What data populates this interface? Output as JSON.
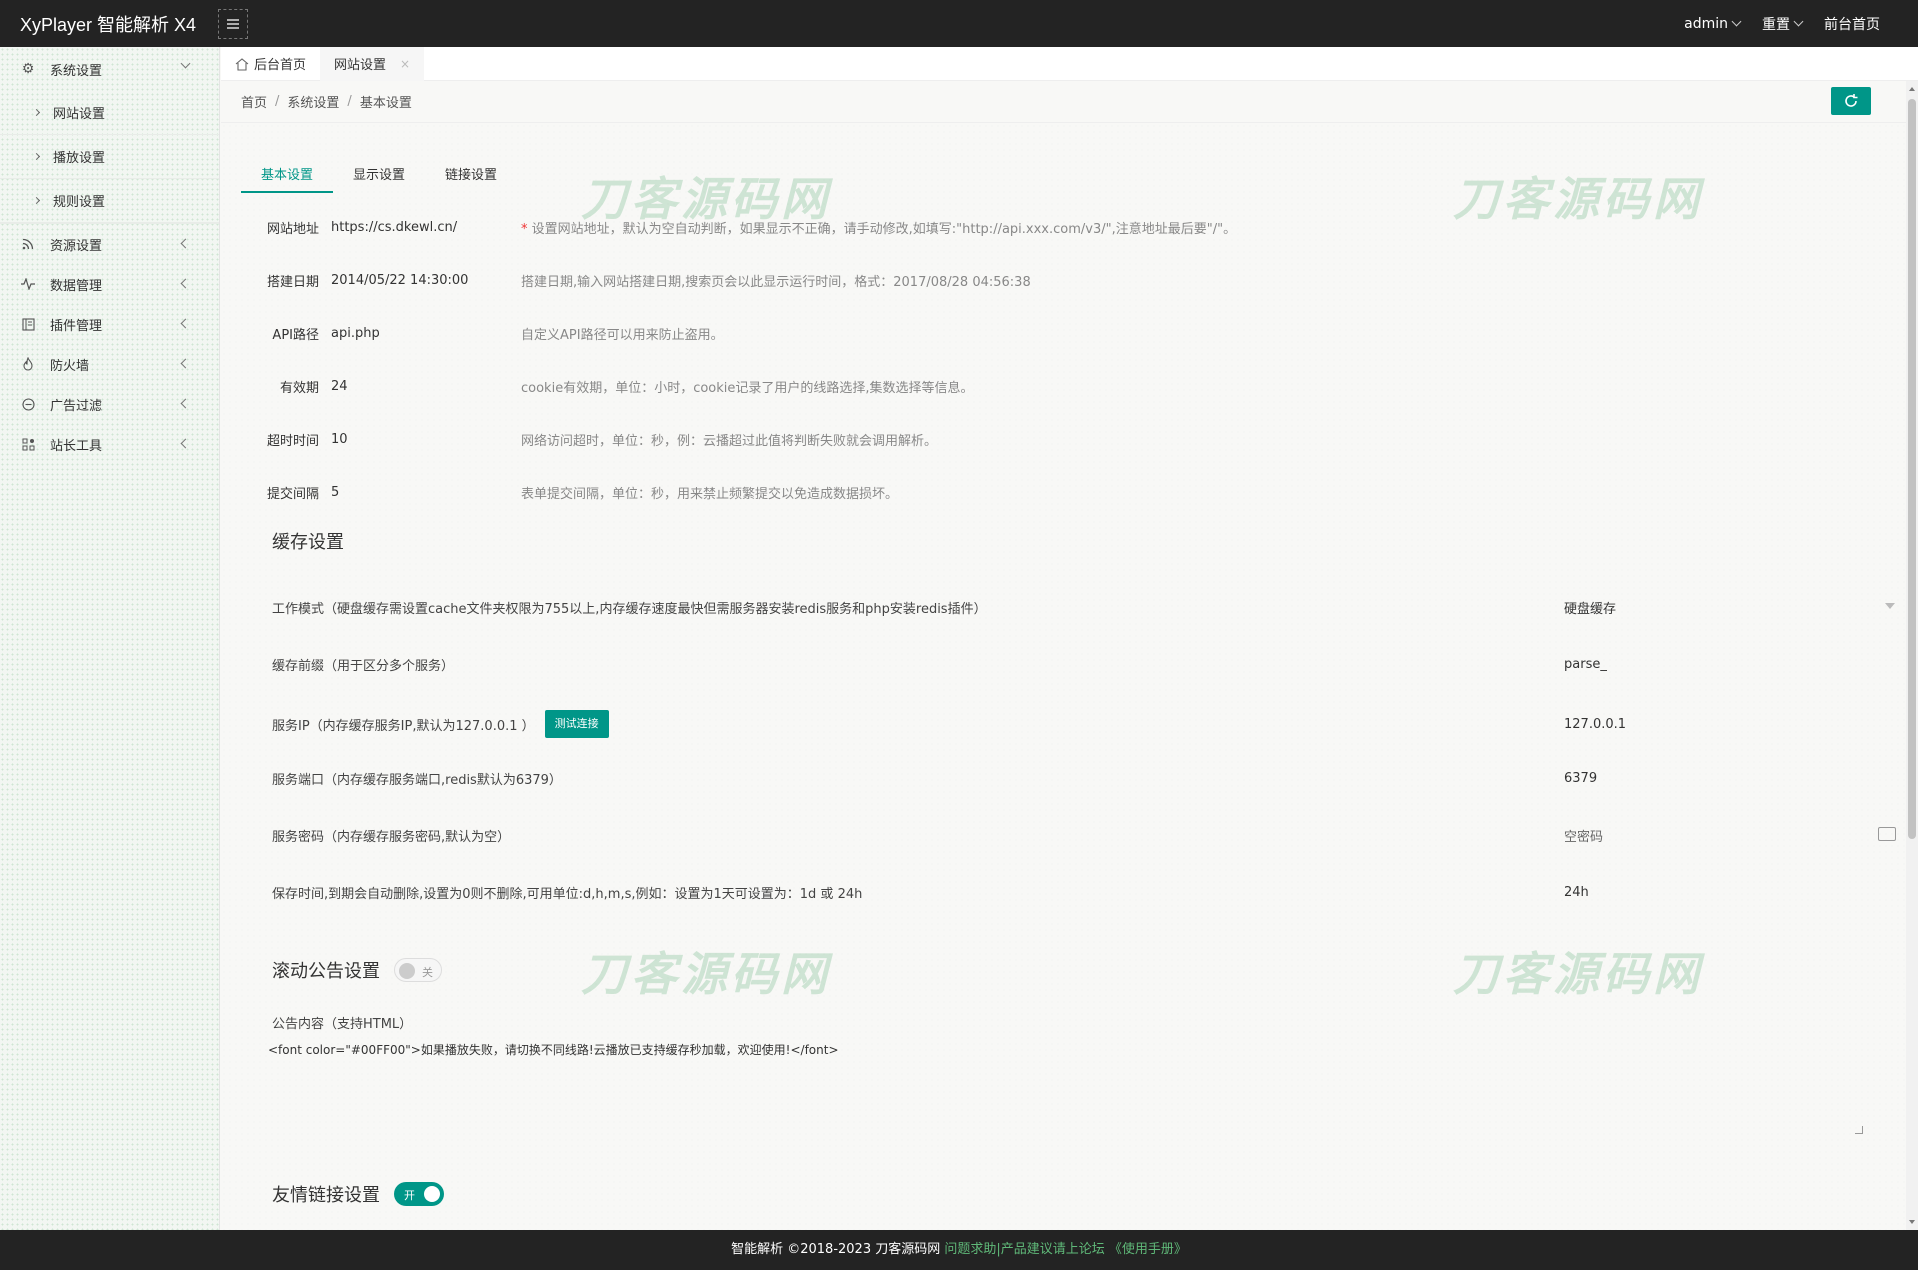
{
  "app": {
    "title": "XyPlayer 智能解析 X4"
  },
  "header": {
    "user": "admin",
    "reset": "重置",
    "front": "前台首页"
  },
  "sidebar": {
    "items": [
      {
        "label": "系统设置",
        "icon": "gear-icon",
        "expanded": true,
        "children": [
          "网站设置",
          "播放设置",
          "规则设置"
        ]
      },
      {
        "label": "资源设置",
        "icon": "rss-icon"
      },
      {
        "label": "数据管理",
        "icon": "pulse-icon"
      },
      {
        "label": "插件管理",
        "icon": "plugin-icon"
      },
      {
        "label": "防火墙",
        "icon": "fire-icon"
      },
      {
        "label": "广告过滤",
        "icon": "minus-circle-icon"
      },
      {
        "label": "站长工具",
        "icon": "apps-icon"
      }
    ]
  },
  "tabs": {
    "home": "后台首页",
    "current": "网站设置",
    "close": "×"
  },
  "breadcrumb": {
    "home": "首页",
    "sep": "/",
    "level2": "系统设置",
    "level3": "基本设置"
  },
  "subtabs": [
    "基本设置",
    "显示设置",
    "链接设置"
  ],
  "basic_fields": [
    {
      "label": "网站地址",
      "value": "https://cs.dkewl.cn/",
      "star": "*",
      "tip": " 设置网站地址，默认为空自动判断，如果显示不正确，请手动修改,如填写:\"http://api.xxx.com/v3/\",注意地址最后要\"/\"。"
    },
    {
      "label": "搭建日期",
      "value": "2014/05/22 14:30:00",
      "star": "",
      "tip": "搭建日期,输入网站搭建日期,搜索页会以此显示运行时间，格式：2017/08/28 04:56:38"
    },
    {
      "label": "API路径",
      "value": "api.php",
      "star": "",
      "tip": "自定义API路径可以用来防止盗用。"
    },
    {
      "label": "有效期",
      "value": "24",
      "star": "",
      "tip": "cookie有效期，单位：小时，cookie记录了用户的线路选择,集数选择等信息。"
    },
    {
      "label": "超时时间",
      "value": "10",
      "star": "",
      "tip": "网络访问超时，单位：秒，例：云播超过此值将判断失败就会调用解析。"
    },
    {
      "label": "提交间隔",
      "value": "5",
      "star": "",
      "tip": "表单提交间隔，单位：秒，用来禁止频繁提交以免造成数据损坏。"
    }
  ],
  "cache": {
    "title": "缓存设置",
    "mode_label": "工作模式（硬盘缓存需设置cache文件夹权限为755以上,内存缓存速度最快但需服务器安装redis服务和php安装redis插件）",
    "mode_value": "硬盘缓存",
    "prefix_label": "缓存前缀（用于区分多个服务）",
    "prefix_value": "parse_",
    "ip_label": "服务IP（内存缓存服务IP,默认为127.0.0.1 ）",
    "test_button": "测试连接",
    "ip_value": "127.0.0.1",
    "port_label": "服务端口（内存缓存服务端口,redis默认为6379）",
    "port_value": "6379",
    "pwd_label": "服务密码（内存缓存服务密码,默认为空）",
    "pwd_placeholder": "空密码",
    "time_label": "保存时间,到期会自动删除,设置为0则不删除,可用单位:d,h,m,s,例如：设置为1天可设置为：1d 或 24h",
    "time_value": "24h"
  },
  "notice": {
    "title": "滚动公告设置",
    "switch_text": "关",
    "switch_on": false,
    "content_label": "公告内容（支持HTML）",
    "content": "<font color=\"#00FF00\">如果播放失败，请切换不同线路!云播放已支持缓存秒加载，欢迎使用!</font>"
  },
  "links": {
    "title": "友情链接设置",
    "switch_text": "开",
    "switch_on": true
  },
  "watermark": "刀客源码网",
  "footer": {
    "main": "智能解析 ©2018-2023 刀客源码网",
    "link": " 问题求助|产品建议请上论坛 《使用手册》"
  },
  "colors": {
    "accent": "#009688",
    "header_bg": "#232323"
  }
}
